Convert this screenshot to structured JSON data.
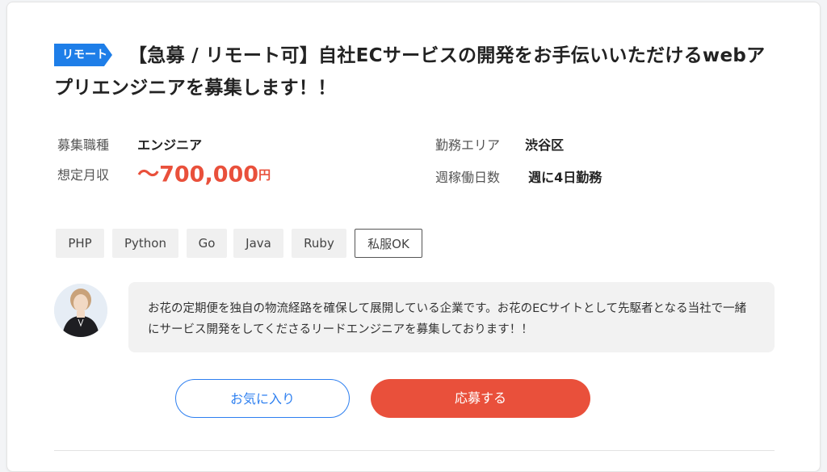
{
  "job": {
    "badge": "リモート",
    "title": "【急募 / リモート可】自社ECサービスの開発をお手伝いいただけるwebアプリエンジニアを募集します！！",
    "info": {
      "type_label": "募集職種",
      "type_value": "エンジニア",
      "salary_label": "想定月収",
      "salary_value": "〜700,000",
      "salary_unit": "円",
      "area_label": "勤務エリア",
      "area_value": "渋谷区",
      "days_label": "週稼働日数",
      "days_value": "週に4日勤務"
    },
    "tags": [
      "PHP",
      "Python",
      "Go",
      "Java",
      "Ruby",
      "私服OK"
    ],
    "message": "お花の定期便を独自の物流経路を確保して展開している企業です。お花のECサイトとして先駆者となる当社で一緒にサービス開発をしてくださるリードエンジニアを募集しております！！",
    "buttons": {
      "favorite": "お気に入り",
      "apply": "応募する"
    }
  },
  "colors": {
    "accent_blue": "#1e7ee8",
    "accent_red": "#e9503b"
  }
}
